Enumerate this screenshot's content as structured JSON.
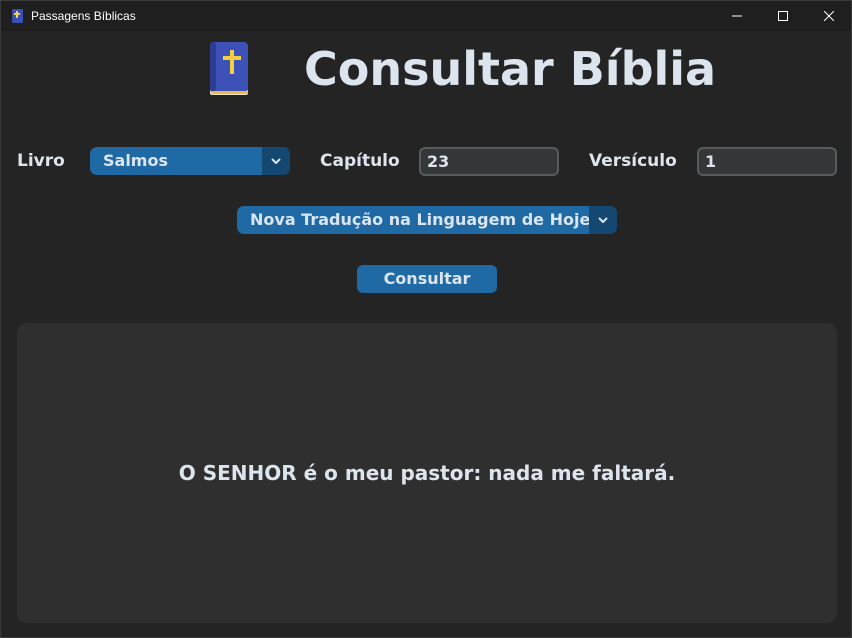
{
  "window": {
    "title": "Passagens Bíblicas",
    "icon": "bible-app-icon",
    "controls": [
      "minimize-icon",
      "maximize-icon",
      "close-icon"
    ]
  },
  "header": {
    "icon": "bible-book-icon",
    "title": "Consultar Bíblia"
  },
  "form": {
    "book_label": "Livro",
    "book_value": "Salmos",
    "chapter_label": "Capítulo",
    "chapter_value": "23",
    "verse_label": "Versículo",
    "verse_value": "1",
    "translation_value": "Nova Tradução na Linguagem de Hoje",
    "submit_label": "Consultar"
  },
  "result": {
    "text": "O SENHOR é o meu pastor: nada me faltará."
  },
  "colors": {
    "background": "#242424",
    "panel": "#2f2f2f",
    "accent": "#1f6aa5",
    "accent_dark": "#144870",
    "entry_bg": "#343638",
    "entry_border": "#565b5e",
    "text": "#dce4ee"
  }
}
